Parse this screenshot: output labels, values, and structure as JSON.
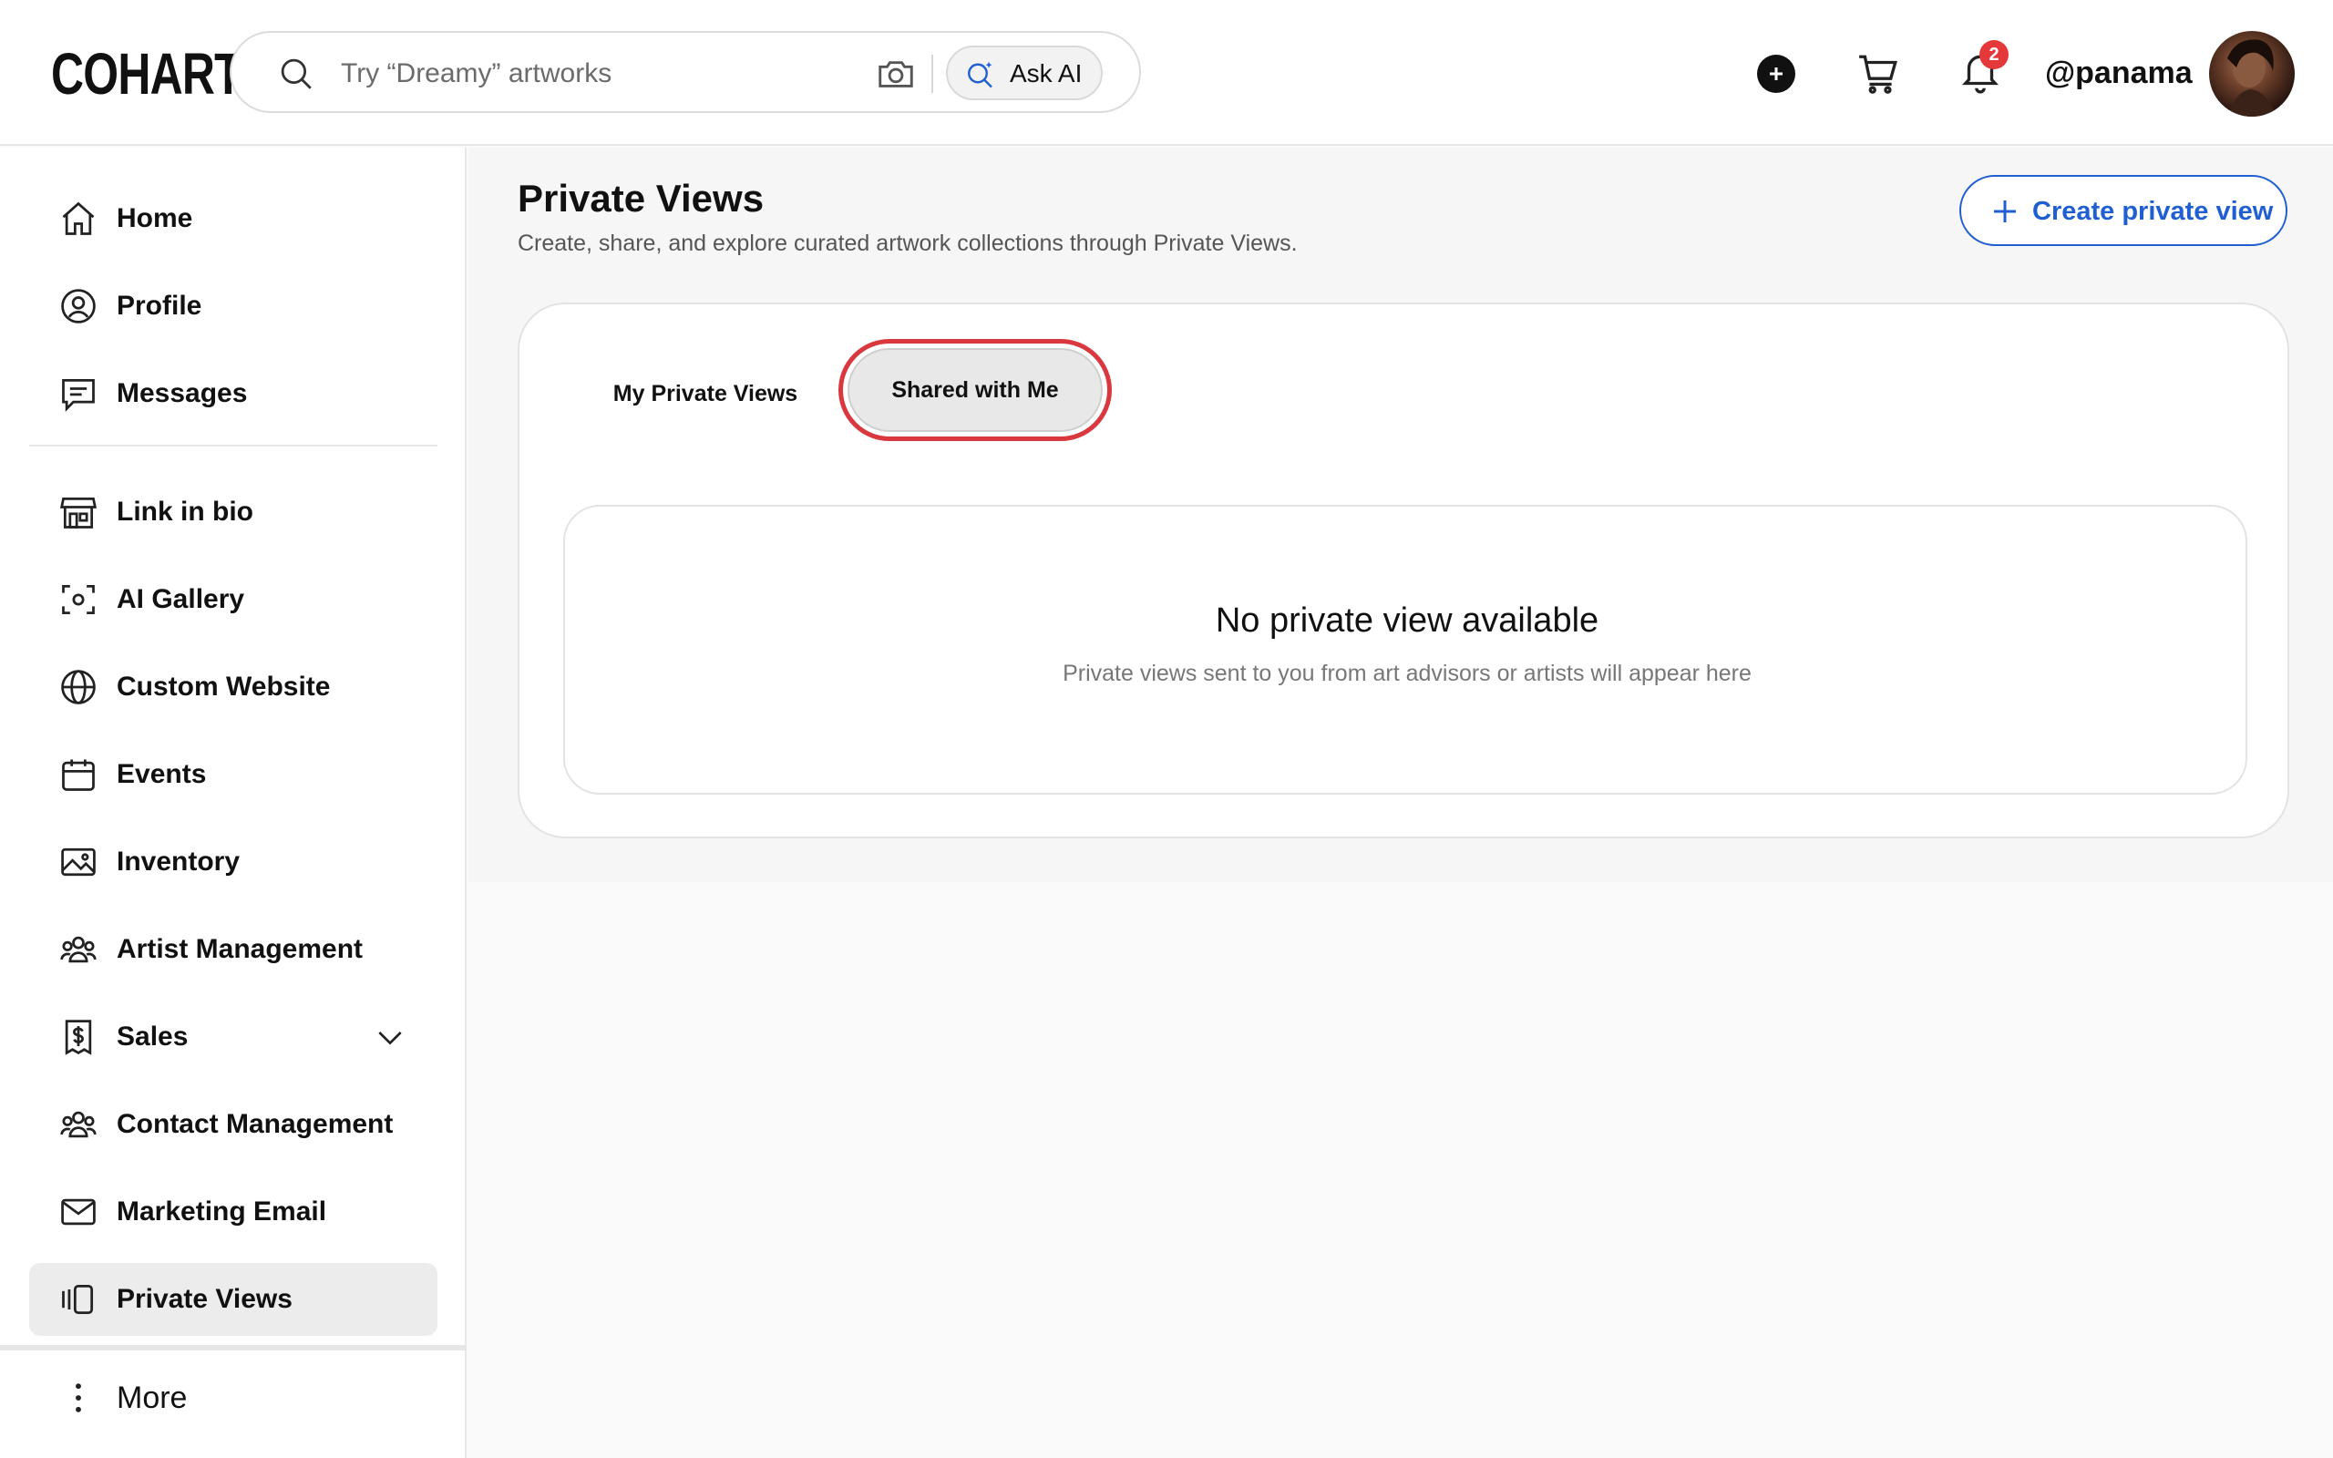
{
  "header": {
    "logo": "COHART",
    "search_placeholder": "Try “Dreamy” artworks",
    "ask_ai_label": "Ask AI",
    "notification_count": "2",
    "username": "@panama"
  },
  "sidebar": {
    "items": [
      {
        "label": "Home",
        "icon": "home-icon"
      },
      {
        "label": "Profile",
        "icon": "user-circle-icon"
      },
      {
        "label": "Messages",
        "icon": "message-icon"
      },
      {
        "label": "Link in bio",
        "icon": "storefront-icon"
      },
      {
        "label": "AI Gallery",
        "icon": "scan-icon"
      },
      {
        "label": "Custom Website",
        "icon": "globe-icon"
      },
      {
        "label": "Events",
        "icon": "calendar-icon"
      },
      {
        "label": "Inventory",
        "icon": "image-icon"
      },
      {
        "label": "Artist Management",
        "icon": "users-icon"
      },
      {
        "label": "Sales",
        "icon": "receipt-dollar-icon"
      },
      {
        "label": "Contact Management",
        "icon": "users-icon"
      },
      {
        "label": "Marketing Email",
        "icon": "mail-icon"
      },
      {
        "label": "Private Views",
        "icon": "private-views-icon",
        "active": true
      }
    ],
    "more_label": "More"
  },
  "main": {
    "title": "Private Views",
    "subtitle": "Create, share, and explore curated artwork collections through Private Views.",
    "create_button": "Create private view",
    "tabs": [
      {
        "label": "My Private Views",
        "selected": false
      },
      {
        "label": "Shared with Me",
        "selected": true
      }
    ],
    "empty_title": "No private view available",
    "empty_subtitle": "Private views sent to you from art advisors or artists will appear here"
  },
  "colors": {
    "accent": "#1f5fd1",
    "highlight_ring": "#d9383f",
    "badge": "#e5383b"
  }
}
